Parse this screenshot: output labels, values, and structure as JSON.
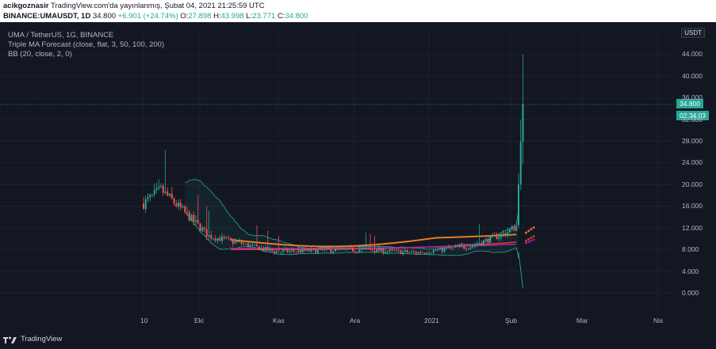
{
  "header": {
    "author": "acikgoznasir",
    "published_text": "TradingView.com'da yayınlanmış, Şubat 04, 2021 21:25:59 UTC",
    "symbol": "BINANCE:UMAUSDT, 1D",
    "last": "34.800",
    "change": "+6.901 (+24.74%)",
    "o_label": "O:",
    "o_value": "27.898",
    "h_label": "H:",
    "h_value": "43.998",
    "l_label": "L:",
    "l_value": "23.771",
    "c_label": "C:",
    "c_value": "34.800"
  },
  "legend": {
    "line1": "UMA / TetherUS, 1G, BINANCE",
    "line2": "Triple MA Forecast (close, flat, 3, 50, 100, 200)",
    "line3": "BB (20, close, 2, 0)"
  },
  "scale_unit": "USDT",
  "price_tag": "34.800",
  "countdown_tag": "02:34:03",
  "brand": "TradingView",
  "colors": {
    "up": "#26a69a",
    "down": "#ef5350",
    "ma_orange": "#e67e22",
    "ma_red": "#e53935",
    "ma_purple": "#9c27b0",
    "bb": "#26a69a"
  },
  "chart_data": {
    "type": "candlestick",
    "y_ticks": [
      "44.000",
      "40.000",
      "36.000",
      "32.000",
      "28.000",
      "24.000",
      "20.000",
      "16.000",
      "12.000",
      "8.000",
      "4.000",
      "0.000"
    ],
    "x_ticks": [
      "10",
      "Eki",
      "Kas",
      "Ara",
      "2021",
      "Şub",
      "Mar",
      "Nis"
    ],
    "ylim": [
      0,
      44
    ],
    "last_price": 34.8,
    "segments": [
      {
        "from": 0,
        "to": 8,
        "start": 16.5,
        "end": 19.0
      },
      {
        "from": 8,
        "to": 30,
        "start": 19.0,
        "end": 10.5
      },
      {
        "from": 30,
        "to": 60,
        "start": 10.5,
        "end": 7.6
      },
      {
        "from": 60,
        "to": 100,
        "start": 7.6,
        "end": 8.0
      },
      {
        "from": 100,
        "to": 125,
        "start": 8.0,
        "end": 7.4
      },
      {
        "from": 125,
        "to": 150,
        "start": 7.4,
        "end": 8.6
      },
      {
        "from": 150,
        "to": 166,
        "start": 8.6,
        "end": 11.0
      },
      {
        "from": 166,
        "to": 172,
        "start": 11.0,
        "end": 12.5
      }
    ],
    "spike": [
      {
        "o": 12.5,
        "h": 22.0,
        "l": 12.0,
        "c": 20.0
      },
      {
        "o": 20.0,
        "h": 32.0,
        "l": 19.0,
        "c": 27.9
      },
      {
        "o": 27.898,
        "h": 43.998,
        "l": 23.771,
        "c": 34.8
      }
    ],
    "ma_start_index": 40,
    "ma_lines": [
      {
        "name": "MA 50",
        "color": "#e67e22",
        "start_value": 9.8,
        "end_value": 10.8
      },
      {
        "name": "MA 100",
        "color": "#e53935",
        "start_value": 8.0,
        "end_value": 9.4
      },
      {
        "name": "MA 200",
        "color": "#9c27b0",
        "start_value": 8.2,
        "end_value": 9.0
      }
    ]
  }
}
